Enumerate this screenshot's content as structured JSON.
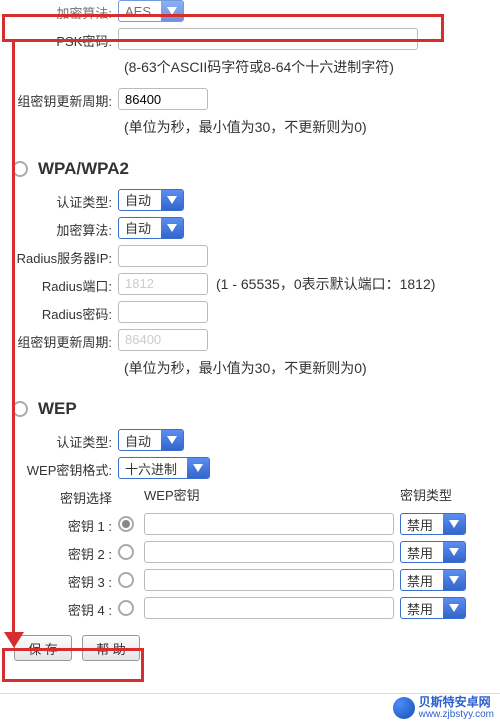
{
  "top": {
    "encrypt_algo_label": "加密算法:",
    "encrypt_algo_value": "AES",
    "psk_label": "PSK密码:",
    "psk_value": "",
    "psk_hint": "(8-63个ASCII码字符或8-64个十六进制字符)",
    "group_key_label": "组密钥更新周期:",
    "group_key_value": "86400",
    "group_key_hint": "(单位为秒，最小值为30，不更新则为0)"
  },
  "wpa": {
    "title": "WPA/WPA2",
    "auth_type_label": "认证类型:",
    "auth_type_value": "自动",
    "encrypt_algo_label": "加密算法:",
    "encrypt_algo_value": "自动",
    "radius_ip_label": "Radius服务器IP:",
    "radius_ip_value": "",
    "radius_port_label": "Radius端口:",
    "radius_port_value": "1812",
    "radius_port_hint": "(1 - 65535，0表示默认端口：1812)",
    "radius_pwd_label": "Radius密码:",
    "radius_pwd_value": "",
    "group_key_label": "组密钥更新周期:",
    "group_key_value": "86400",
    "group_key_hint": "(单位为秒，最小值为30，不更新则为0)"
  },
  "wep": {
    "title": "WEP",
    "auth_type_label": "认证类型:",
    "auth_type_value": "自动",
    "format_label": "WEP密钥格式:",
    "format_value": "十六进制",
    "select_label": "密钥选择",
    "key_header": "WEP密钥",
    "type_header": "密钥类型",
    "keys": [
      {
        "label": "密钥 1 :",
        "value": "",
        "type": "禁用",
        "checked": true
      },
      {
        "label": "密钥 2 :",
        "value": "",
        "type": "禁用",
        "checked": false
      },
      {
        "label": "密钥 3 :",
        "value": "",
        "type": "禁用",
        "checked": false
      },
      {
        "label": "密钥 4 :",
        "value": "",
        "type": "禁用",
        "checked": false
      }
    ]
  },
  "buttons": {
    "save": "保 存",
    "help": "帮 助"
  },
  "footer": {
    "brand": "贝斯特安卓网",
    "url": "www.zjbstyy.com"
  }
}
